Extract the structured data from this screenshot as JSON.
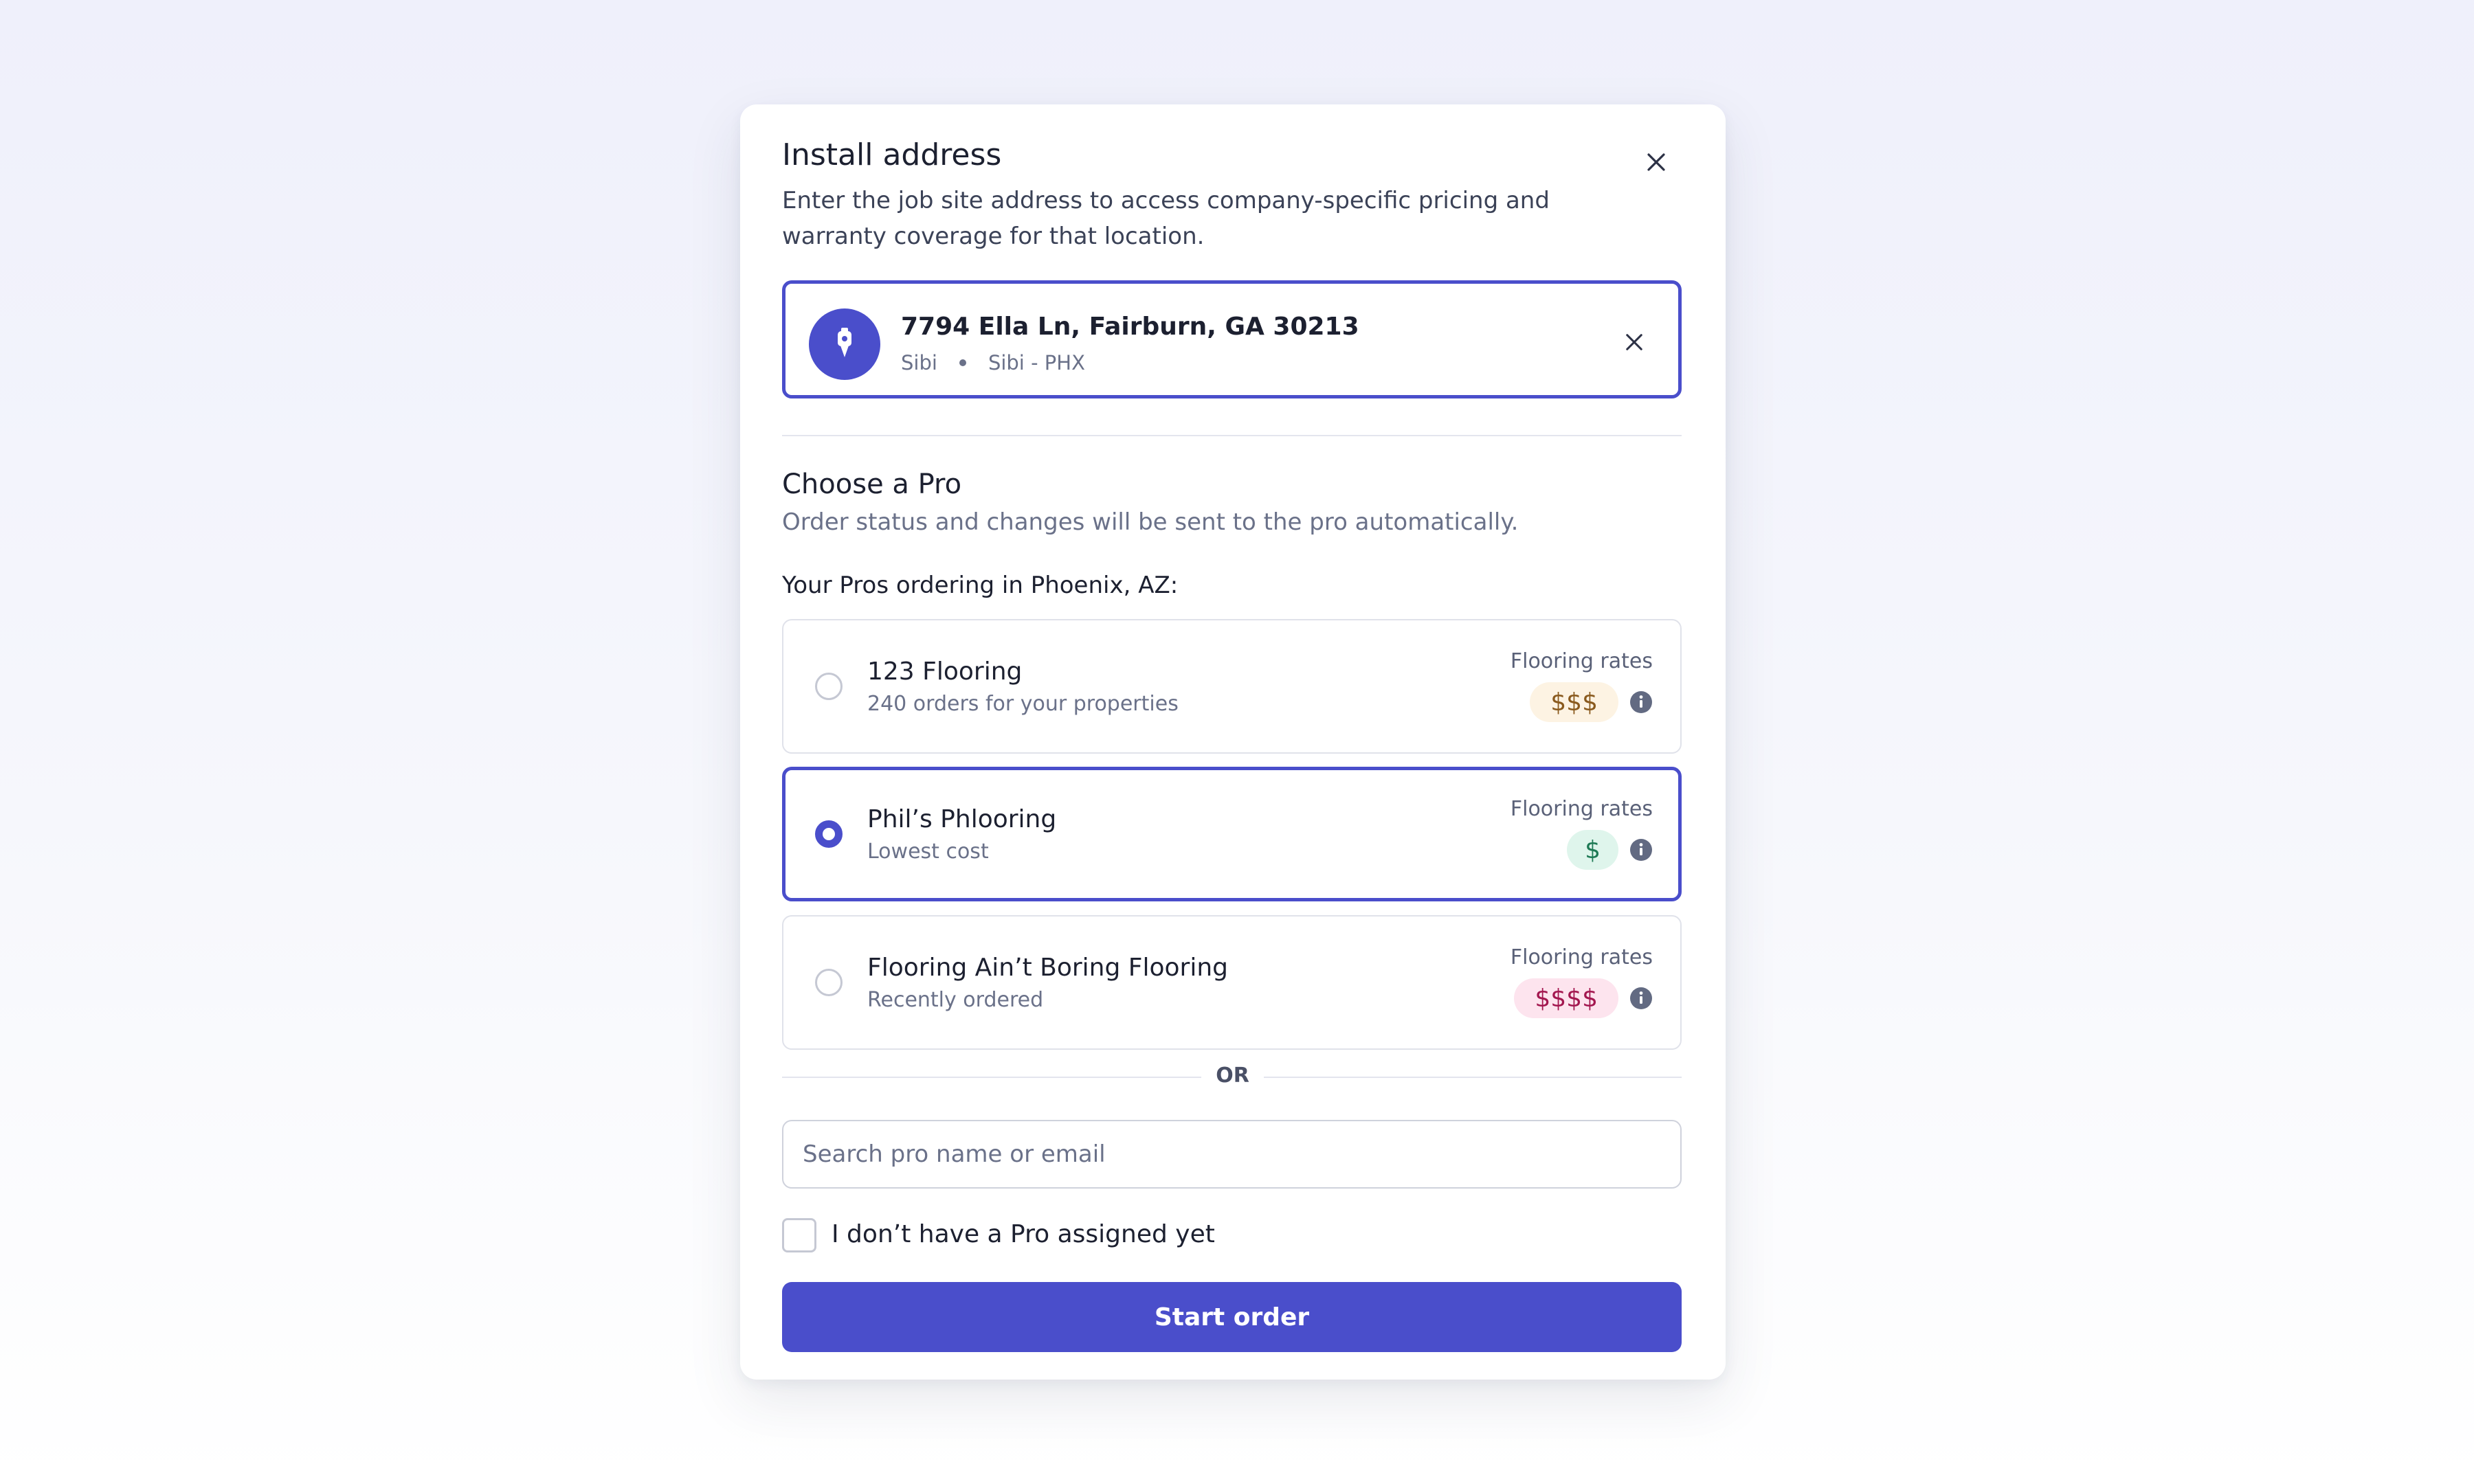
{
  "modal": {
    "title": "Install address",
    "description": "Enter the job site address to access company-specific pricing and warranty coverage for that location."
  },
  "address": {
    "line": "7794 Ella Ln, Fairburn, GA 30213",
    "company": "Sibi",
    "branch": "Sibi - PHX",
    "icon": "map-pin-icon",
    "accent_color": "#4a4ecb"
  },
  "pro_section": {
    "title": "Choose a Pro",
    "description": "Order status and changes will be sent to the pro automatically.",
    "list_label": "Your Pros ordering in Phoenix, AZ:"
  },
  "pros": [
    {
      "name": "123 Flooring",
      "meta": "240 orders for your properties",
      "rates_label": "Flooring rates",
      "rate": "$$$",
      "rate_bg": "#fdf3e3",
      "rate_color": "#8a5a1e",
      "selected": false
    },
    {
      "name": "Phil’s Phlooring",
      "meta": "Lowest cost",
      "rates_label": "Flooring rates",
      "rate": "$",
      "rate_bg": "#dff5ec",
      "rate_color": "#1e7a55",
      "selected": true
    },
    {
      "name": "Flooring Ain’t Boring Flooring",
      "meta": "Recently ordered",
      "rates_label": "Flooring rates",
      "rate": "$$$$",
      "rate_bg": "#fde4ee",
      "rate_color": "#a3174f",
      "selected": false
    }
  ],
  "divider_text": "OR",
  "search": {
    "placeholder": "Search pro name or email",
    "value": ""
  },
  "no_pro": {
    "label": "I don’t have a Pro assigned yet",
    "checked": false
  },
  "actions": {
    "start_label": "Start order"
  }
}
